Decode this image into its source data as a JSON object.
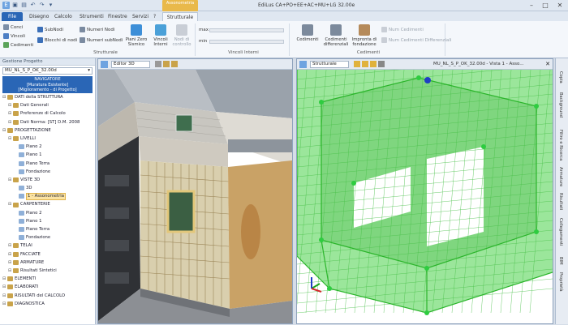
{
  "app": {
    "title": "EdiLus CA+PO+EE+AC+MU+LG 32.00e",
    "context_tab": "Assonometria"
  },
  "tabs": [
    "File",
    "Disegno",
    "Calcolo",
    "Strumenti",
    "Finestre",
    "Servizi",
    "?",
    "Strutturale"
  ],
  "ribbon": {
    "g1": {
      "conci": "Conci",
      "vincoli": "Vincoli",
      "cedimenti": "Cedimenti",
      "subnodi": "SubNodi",
      "blocchi": "Blocchi di nodi",
      "numeri_nodi": "Numeri Nodi",
      "numeri_subnodi": "Numeri subNodi",
      "piani_zero": "Piani Zero Sismico",
      "vincoli_interni": "Vincoli Interni",
      "nodi_controllo": "Nodi di controllo",
      "label": "Strutturale"
    },
    "g2": {
      "max": "max",
      "min": "min",
      "label": "Vincoli Interni"
    },
    "g3": {
      "cedimenti": "Cedimenti",
      "cedimenti_diff": "Cedimenti differenziali",
      "impronta": "Impronta di fondazione",
      "num_cedimenti": "Num Cedimenti",
      "num_ced_diff": "Num Cedimenti Differenziali",
      "label": "Cedimenti"
    }
  },
  "left": {
    "header": "Gestione Progetto",
    "combo": "MU_NL_S_P_OK_32.00d",
    "nav": [
      "NAVIGATORE",
      "[Muratura Esistente]",
      "[Miglioramento - di Progetto]"
    ],
    "tree": [
      "DATI della STRUTTURA",
      "Dati Generali",
      "Preferenze di Calcolo",
      "Dati Norma: [ST] D.M. 2008",
      "PROGETTAZIONE",
      "LIVELLI",
      "Piano 2",
      "Piano 1",
      "Piano Terra",
      "Fondazione",
      "VISTE 3D",
      "3D",
      "1 - Assonometria",
      "CARPENTERIE",
      "Piano 2",
      "Piano 1",
      "Piano Terra",
      "Fondazione",
      "TELAI",
      "FACCIATE",
      "ARMATURE",
      "Risultati Sintetici",
      "ELEMENTI",
      "ELABORATI",
      "RISULTATI del CALCOLO",
      "DIAGNOSTICA"
    ]
  },
  "editor": {
    "combo": "Editor 3D"
  },
  "struct": {
    "combo": "Strutturale",
    "title": "MU_NL_S_P_OK_32.00d - Vista 1 - Asso..."
  },
  "side": [
    "Copia",
    "Background",
    "Filtro e Ricerca",
    "Armature",
    "Risultati",
    "Collegamenti",
    "BIM",
    "Proprietà"
  ],
  "colors": {
    "accent": "#2a66b6",
    "context": "#e9b94a",
    "mesh": "#33cc33",
    "selection": "#fbe3a2"
  },
  "icons": [
    "save-icon",
    "undo-icon",
    "redo-icon",
    "close-icon"
  ]
}
